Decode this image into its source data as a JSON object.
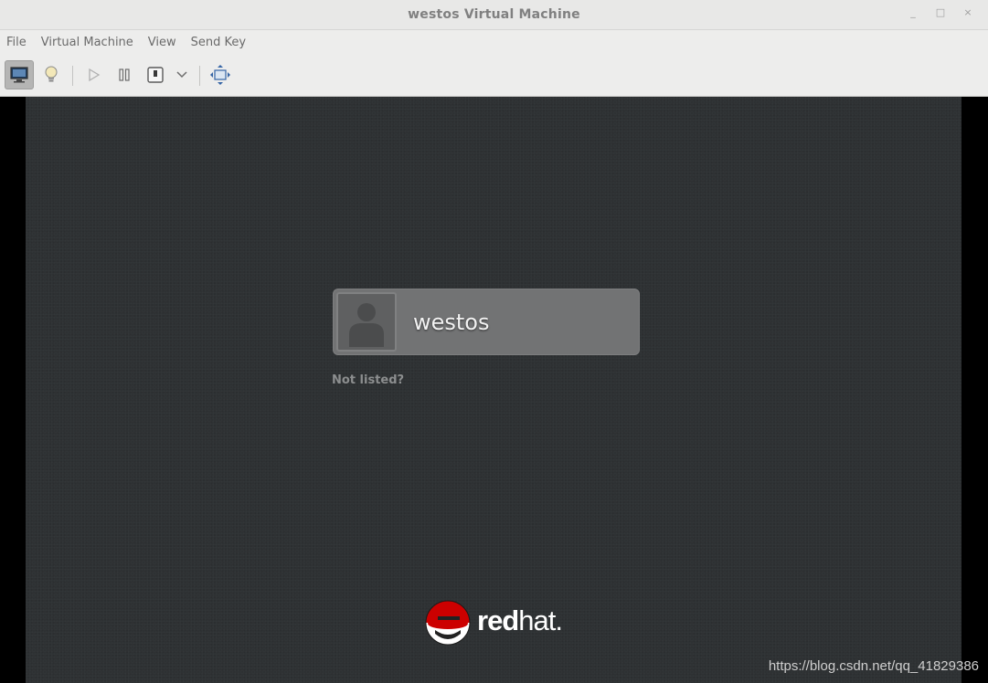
{
  "window": {
    "title": "westos Virtual Machine",
    "controls": {
      "minimize": "_",
      "maximize": "□",
      "close": "×"
    }
  },
  "menubar": {
    "items": [
      {
        "label": "File"
      },
      {
        "label": "Virtual Machine"
      },
      {
        "label": "View"
      },
      {
        "label": "Send Key"
      }
    ]
  },
  "toolbar": {
    "buttons": [
      {
        "icon": "monitor-icon",
        "active": true
      },
      {
        "icon": "lightbulb-icon",
        "active": false
      },
      {
        "icon": "play-icon",
        "active": false
      },
      {
        "icon": "pause-icon",
        "active": false
      },
      {
        "icon": "power-icon",
        "active": false
      },
      {
        "icon": "chevron-down-icon",
        "active": false
      },
      {
        "icon": "fullscreen-icon",
        "active": false
      }
    ]
  },
  "login": {
    "user_name": "westos",
    "not_listed": "Not listed?"
  },
  "brand": {
    "word_bold": "red",
    "word_light": "hat",
    "suffix": "."
  },
  "watermark": "https://blog.csdn.net/qq_41829386",
  "colors": {
    "screen_bg": "#2e3133",
    "card_bg": "#727374",
    "redhat_red": "#cc0000"
  }
}
